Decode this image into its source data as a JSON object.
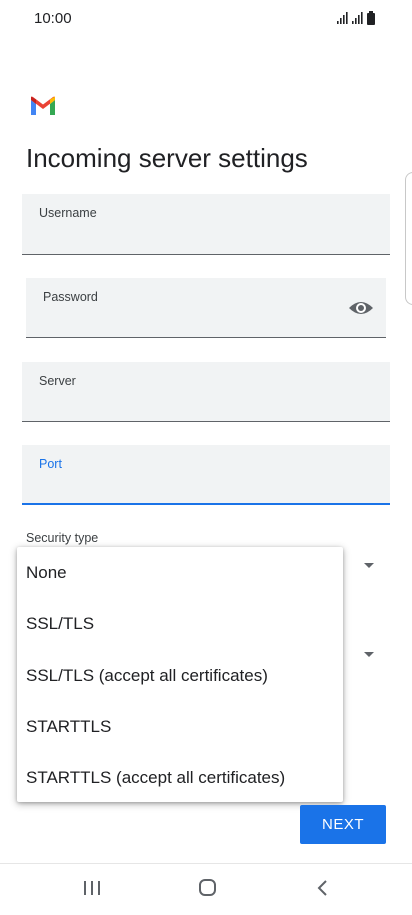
{
  "status_bar": {
    "time": "10:00",
    "icons": [
      "signal-icon",
      "signal-icon",
      "battery-icon"
    ]
  },
  "app": {
    "logo": "gmail-logo",
    "colors": {
      "accent": "#1a73e8",
      "field_bg": "#f1f3f4"
    }
  },
  "page": {
    "title": "Incoming server settings"
  },
  "form": {
    "username_label": "Username",
    "password_label": "Password",
    "server_label": "Server",
    "port_label": "Port",
    "security_type_label": "Security type"
  },
  "dropdown": {
    "options": [
      "None",
      "SSL/TLS",
      "SSL/TLS (accept all certificates)",
      "STARTTLS",
      "STARTTLS (accept all certificates)"
    ]
  },
  "actions": {
    "next_label": "NEXT"
  },
  "nav_bar": {
    "icons": [
      "recents-icon",
      "home-icon",
      "back-icon"
    ]
  }
}
